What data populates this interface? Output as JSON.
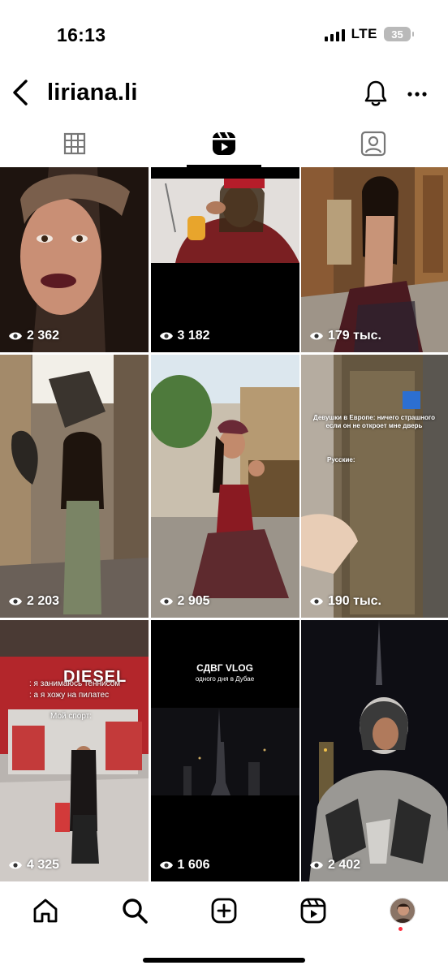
{
  "status_bar": {
    "time": "16:13",
    "network": "LTE",
    "battery": "35"
  },
  "header": {
    "username": "liriana.li",
    "back_icon": "chevron-left-icon",
    "notifications_icon": "bell-icon",
    "more_icon": "more-horizontal-icon"
  },
  "tabs": [
    {
      "name": "grid",
      "icon": "grid-icon"
    },
    {
      "name": "reels",
      "icon": "reels-icon",
      "active": true
    },
    {
      "name": "tagged",
      "icon": "tagged-person-icon"
    }
  ],
  "posts": [
    {
      "views": "2 362"
    },
    {
      "views": "3 182"
    },
    {
      "views": "179 тыс."
    },
    {
      "views": "2 203"
    },
    {
      "views": "2 905"
    },
    {
      "views": "190 тыс.",
      "overlay": [
        "Девушки в Европе: ничего страшного если он не откроет мне дверь",
        "Русские:"
      ]
    },
    {
      "views": "4 325",
      "overlay": [
        ": я занимаюсь теннисом",
        ": а я хожу на пилатес",
        "Мой спорт:"
      ],
      "sign": "DIESEL"
    },
    {
      "views": "1 606",
      "overlay": [
        "СДВГ VLOG",
        "одного дня в Дубае"
      ]
    },
    {
      "views": "2 402"
    }
  ],
  "bottom_nav": {
    "items": [
      "home-icon",
      "search-icon",
      "create-icon",
      "reels-icon",
      "profile-avatar"
    ]
  },
  "colors": {
    "notification_dot": "#ff3040",
    "text": "#000000",
    "background": "#ffffff"
  }
}
